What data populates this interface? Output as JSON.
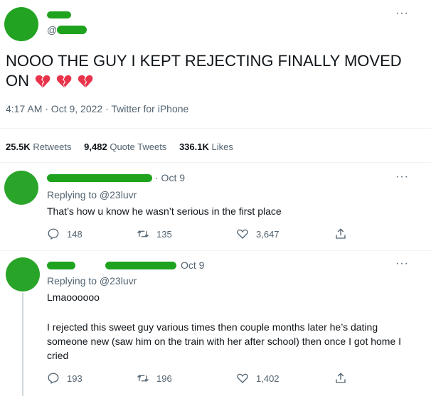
{
  "tweet": {
    "handle_prefix": "@",
    "text_line1": "NOOO THE GUY I KEPT REJECTING FINALLY MOVED",
    "text_line2": "ON",
    "timestamp": "4:17 AM · Oct 9, 2022 · Twitter for iPhone",
    "stats": {
      "retweets_num": "25.5K",
      "retweets_label": "Retweets",
      "quotes_num": "9,482",
      "quotes_label": "Quote Tweets",
      "likes_num": "336.1K",
      "likes_label": "Likes"
    },
    "more": "···"
  },
  "replies": [
    {
      "date": "· Oct 9",
      "replying_to": "Replying to @23luvr",
      "text": "That’s how u know he wasn’t serious in the first place",
      "reply_count": "148",
      "retweet_count": "135",
      "like_count": "3,647"
    },
    {
      "date": "Oct 9",
      "replying_to": "Replying to @23luvr",
      "text1": "Lmaoooooo",
      "text2": "I rejected this sweet guy various times then couple months later he’s dating someone new (saw him on the train with her after school) then once I got home I cried",
      "reply_count": "193",
      "retweet_count": "196",
      "like_count": "1,402"
    }
  ],
  "colors": {
    "accent": "#1d9bf0",
    "heart": "#e8334a",
    "redaction": "#1fa31f"
  }
}
